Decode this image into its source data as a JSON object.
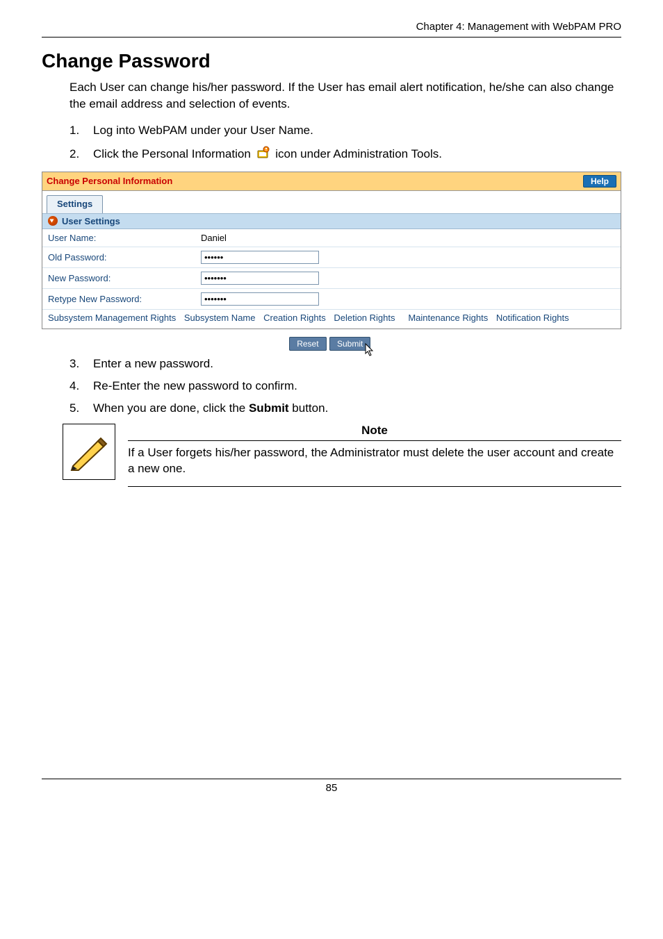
{
  "header": {
    "breadcrumb": "Chapter 4: Management with WebPAM PRO"
  },
  "title": "Change Password",
  "intro": "Each User can change his/her password. If the User has email alert notification, he/she can also change the email address and selection of events.",
  "steps": {
    "s1": "Log into WebPAM under your User Name.",
    "s2a": "Click the Personal Information ",
    "s2b": " icon under Administration Tools.",
    "s3": "Enter a new password.",
    "s4": "Re-Enter the new password to confirm.",
    "s5a": "When you are done, click the ",
    "s5b": "Submit",
    "s5c": " button."
  },
  "panel": {
    "title": "Change Personal Information",
    "help_label": "Help",
    "tab_label": "Settings",
    "section_label": "User Settings",
    "rows": {
      "username_label": "User Name:",
      "username_value": "Daniel",
      "oldpw_label": "Old Password:",
      "oldpw_value": "••••••",
      "newpw_label": "New Password:",
      "newpw_value": "•••••••",
      "retype_label": "Retype New Password:",
      "retype_value": "•••••••"
    },
    "rights": {
      "c1": "Subsystem Management Rights",
      "c2": "Subsystem Name",
      "c3": "Creation Rights",
      "c4": "Deletion Rights",
      "c5": "Maintenance Rights",
      "c6": "Notification Rights"
    },
    "buttons": {
      "reset": "Reset",
      "submit": "Submit"
    }
  },
  "note": {
    "heading": "Note",
    "text": "If a User forgets his/her password, the Administrator must delete the user account and create a new one."
  },
  "footer": {
    "page_number": "85"
  }
}
